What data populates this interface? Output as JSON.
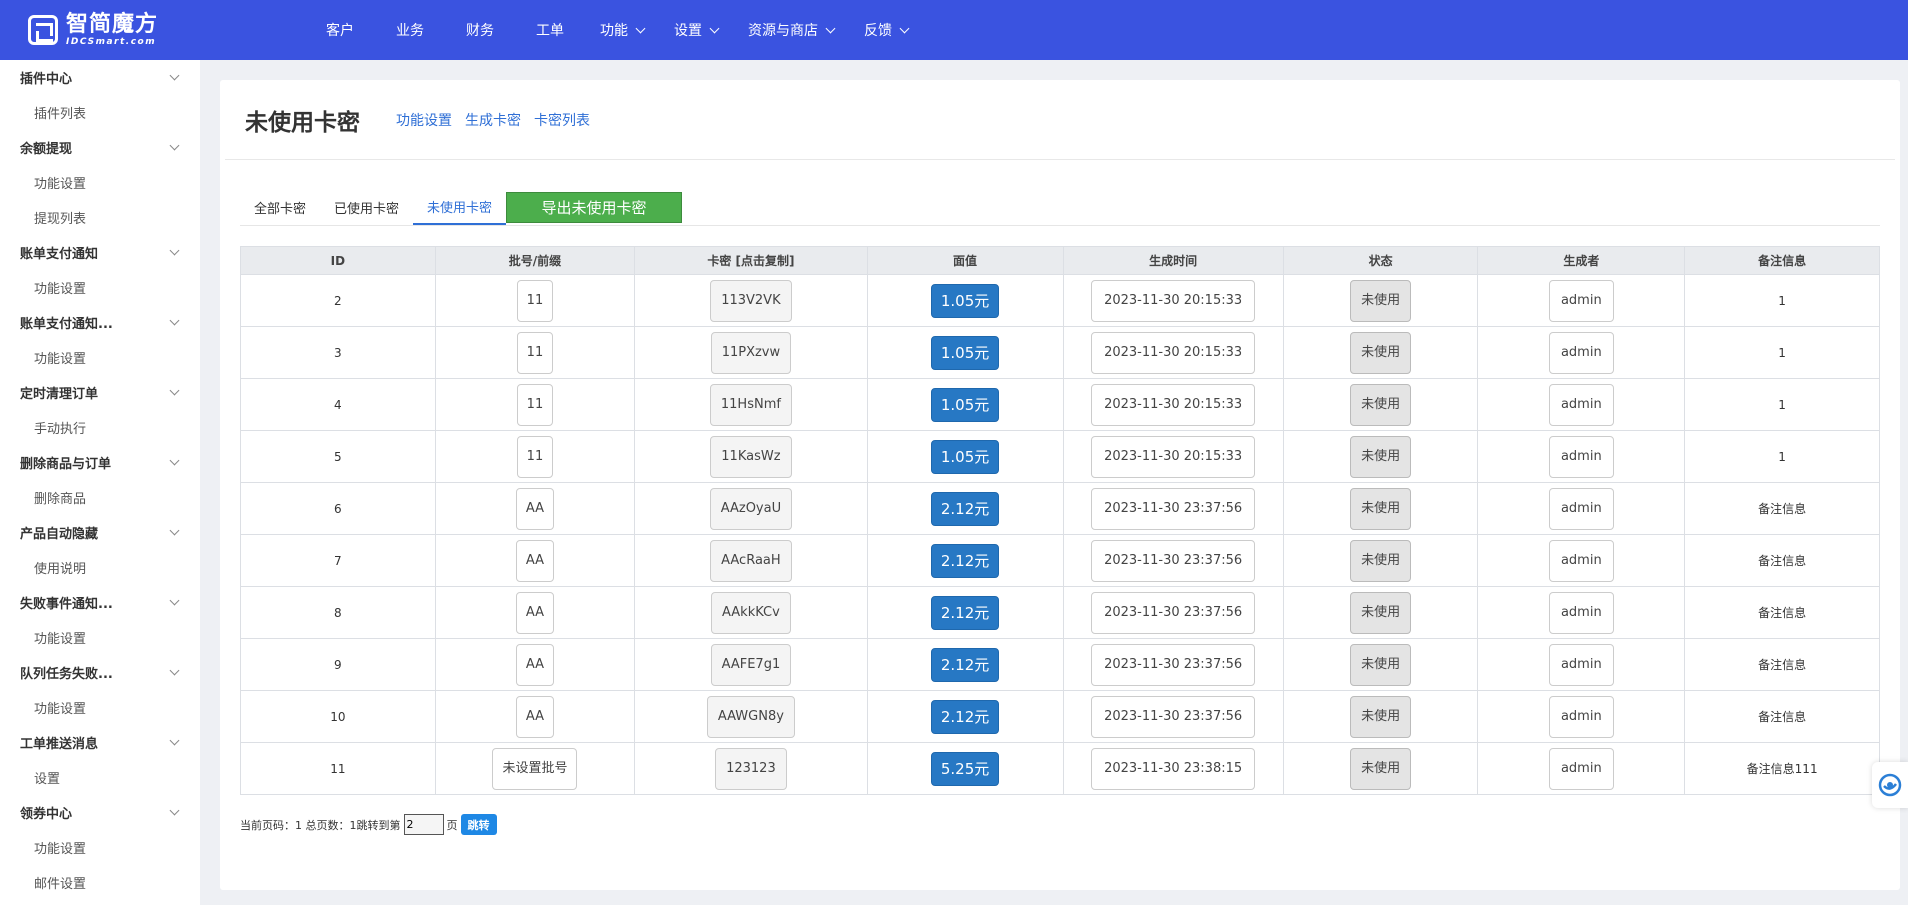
{
  "brand": {
    "name_cn": "智简魔方",
    "name_en": "IDCSmart.com"
  },
  "nav": [
    {
      "label": "客户",
      "dropdown": false
    },
    {
      "label": "业务",
      "dropdown": false
    },
    {
      "label": "财务",
      "dropdown": false
    },
    {
      "label": "工单",
      "dropdown": false
    },
    {
      "label": "功能",
      "dropdown": true
    },
    {
      "label": "设置",
      "dropdown": true
    },
    {
      "label": "资源与商店",
      "dropdown": true
    },
    {
      "label": "反馈",
      "dropdown": true
    }
  ],
  "sidebar": [
    {
      "group": "插件中心",
      "items": [
        "插件列表"
      ]
    },
    {
      "group": "余额提现",
      "items": [
        "功能设置",
        "提现列表"
      ]
    },
    {
      "group": "账单支付通知",
      "items": [
        "功能设置"
      ]
    },
    {
      "group": "账单支付通知...",
      "items": [
        "功能设置"
      ]
    },
    {
      "group": "定时清理订单",
      "items": [
        "手动执行"
      ]
    },
    {
      "group": "删除商品与订单",
      "items": [
        "删除商品"
      ]
    },
    {
      "group": "产品自动隐藏",
      "items": [
        "使用说明"
      ]
    },
    {
      "group": "失败事件通知...",
      "items": [
        "功能设置"
      ]
    },
    {
      "group": "队列任务失败...",
      "items": [
        "功能设置"
      ]
    },
    {
      "group": "工单推送消息",
      "items": [
        "设置"
      ]
    },
    {
      "group": "领券中心",
      "items": [
        "功能设置",
        "邮件设置"
      ]
    }
  ],
  "page": {
    "title": "未使用卡密",
    "header_links": [
      "功能设置",
      "生成卡密",
      "卡密列表"
    ]
  },
  "tabs": [
    "全部卡密",
    "已使用卡密",
    "未使用卡密"
  ],
  "active_tab": 2,
  "export_button": "导出未使用卡密",
  "table": {
    "columns": [
      "ID",
      "批号/前缀",
      "卡密 [点击复制]",
      "面值",
      "生成时间",
      "状态",
      "生成者",
      "备注信息"
    ],
    "rows": [
      {
        "id": "2",
        "batch": "11",
        "code": "113V2VK",
        "value": "1.05元",
        "time": "2023-11-30 20:15:33",
        "status": "未使用",
        "creator": "admin",
        "note": "1"
      },
      {
        "id": "3",
        "batch": "11",
        "code": "11PXzvw",
        "value": "1.05元",
        "time": "2023-11-30 20:15:33",
        "status": "未使用",
        "creator": "admin",
        "note": "1"
      },
      {
        "id": "4",
        "batch": "11",
        "code": "11HsNmf",
        "value": "1.05元",
        "time": "2023-11-30 20:15:33",
        "status": "未使用",
        "creator": "admin",
        "note": "1"
      },
      {
        "id": "5",
        "batch": "11",
        "code": "11KasWz",
        "value": "1.05元",
        "time": "2023-11-30 20:15:33",
        "status": "未使用",
        "creator": "admin",
        "note": "1"
      },
      {
        "id": "6",
        "batch": "AA",
        "code": "AAzOyaU",
        "value": "2.12元",
        "time": "2023-11-30 23:37:56",
        "status": "未使用",
        "creator": "admin",
        "note": "备注信息"
      },
      {
        "id": "7",
        "batch": "AA",
        "code": "AAcRaaH",
        "value": "2.12元",
        "time": "2023-11-30 23:37:56",
        "status": "未使用",
        "creator": "admin",
        "note": "备注信息"
      },
      {
        "id": "8",
        "batch": "AA",
        "code": "AAkkKCv",
        "value": "2.12元",
        "time": "2023-11-30 23:37:56",
        "status": "未使用",
        "creator": "admin",
        "note": "备注信息"
      },
      {
        "id": "9",
        "batch": "AA",
        "code": "AAFE7g1",
        "value": "2.12元",
        "time": "2023-11-30 23:37:56",
        "status": "未使用",
        "creator": "admin",
        "note": "备注信息"
      },
      {
        "id": "10",
        "batch": "AA",
        "code": "AAWGN8y",
        "value": "2.12元",
        "time": "2023-11-30 23:37:56",
        "status": "未使用",
        "creator": "admin",
        "note": "备注信息"
      },
      {
        "id": "11",
        "batch": "未设置批号",
        "code": "123123",
        "value": "5.25元",
        "time": "2023-11-30 23:38:15",
        "status": "未使用",
        "creator": "admin",
        "note": "备注信息111"
      }
    ]
  },
  "pager": {
    "summary": "当前页码：1 总页数：1",
    "jump_prefix": "跳转到第",
    "jump_value": "2",
    "jump_suffix": "页",
    "jump_button": "跳转"
  },
  "icons": {
    "help": "customer-service-icon"
  },
  "colors": {
    "topbar": "#3a53e0",
    "link": "#2f6fd6",
    "export": "#4cae4c",
    "face_value": "#2778c4",
    "jump": "#1e88e5"
  }
}
